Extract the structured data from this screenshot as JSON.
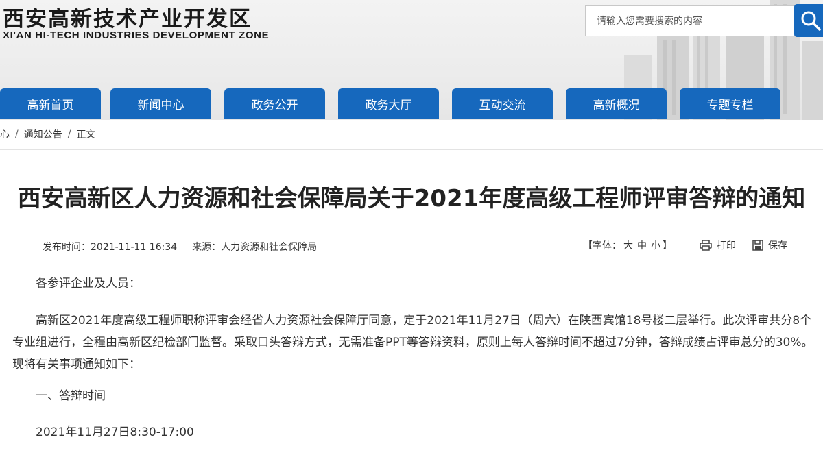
{
  "header": {
    "logo_cn": "西安高新技术产业开发区",
    "logo_en": "XI'AN HI-TECH INDUSTRIES DEVELOPMENT ZONE",
    "search_placeholder": "请输入您需要搜索的内容"
  },
  "nav": {
    "items": [
      "高新首页",
      "新闻中心",
      "政务公开",
      "政务大厅",
      "互动交流",
      "高新概况",
      "专题专栏"
    ]
  },
  "breadcrumb": {
    "items": [
      "心",
      "通知公告",
      "正文"
    ],
    "separator": "/"
  },
  "article": {
    "title": "西安高新区人力资源和社会保障局关于2021年度高级工程师评审答辩的通知",
    "publish_label": "发布时间：",
    "publish_time": "2021-11-11 16:34",
    "source_label": "来源：",
    "source": "人力资源和社会保障局",
    "font_size_label": "【字体：",
    "font_sizes": [
      "大",
      "中",
      "小"
    ],
    "font_size_close": "】",
    "print_label": "打印",
    "save_label": "保存",
    "greeting": "各参评企业及人员：",
    "main_paragraph": "高新区2021年度高级工程师职称评审会经省人力资源社会保障厅同意，定于2021年11月27日（周六）在陕西宾馆18号楼二层举行。此次评审共分8个专业组进行，全程由高新区纪检部门监督。采取口头答辩方式，无需准备PPT等答辩资料，原则上每人答辩时间不超过7分钟，答辩成绩占评审总分的30%。现将有关事项通知如下：",
    "section1_heading": "一、答辩时间",
    "section1_time": "2021年11月27日8:30-17:00"
  },
  "colors": {
    "brand_blue": "#1668bd",
    "header_bg": "#ececec"
  },
  "icons": {
    "search": "search-icon",
    "print": "printer-icon",
    "save": "floppy-disk-icon"
  }
}
